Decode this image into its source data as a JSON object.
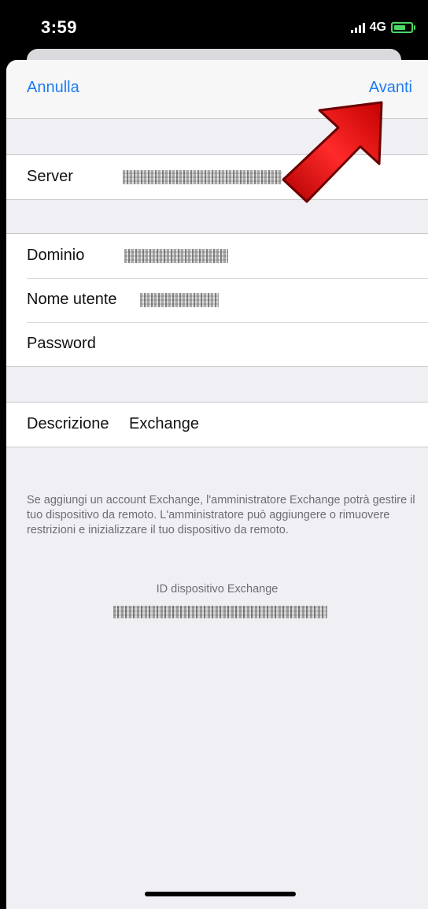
{
  "status_bar": {
    "time": "3:59",
    "network": "4G",
    "signal_icon": "signal-bars-icon",
    "battery_icon": "battery-charging-icon",
    "battery_color": "#4cd964"
  },
  "navbar": {
    "cancel_label": "Annulla",
    "next_label": "Avanti",
    "accent_color": "#1e7cf2"
  },
  "server_group": {
    "server_label": "Server"
  },
  "account_group": {
    "domain_label": "Dominio",
    "username_label": "Nome utente",
    "password_label": "Password"
  },
  "description_group": {
    "label": "Descrizione",
    "value": "Exchange"
  },
  "footer": {
    "text": "Se aggiungi un account Exchange, l'amministratore Exchange potrà gestire il tuo dispositivo da remoto. L'amministratore può aggiungere o rimuovere restrizioni e inizializzare il tuo dispositivo da remoto.",
    "device_id_label": "ID dispositivo Exchange"
  },
  "annotation": {
    "icon": "red-arrow-icon",
    "color": "#e0141b"
  }
}
